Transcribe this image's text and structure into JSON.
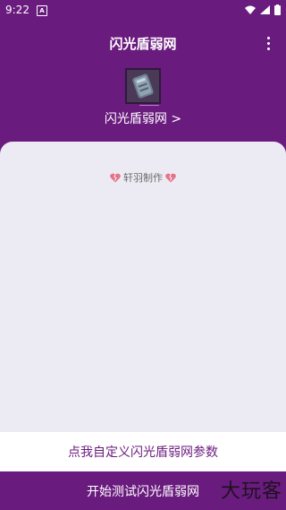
{
  "status": {
    "time": "9:22",
    "notification_glyph": "A"
  },
  "appbar": {
    "title": "闪光盾弱网",
    "menu_icon": "more-vertical-icon"
  },
  "hero": {
    "link_text": "闪光盾弱网 >"
  },
  "panel": {
    "credit_text": "轩羽制作"
  },
  "buttons": {
    "custom_label": "点我自定义闪光盾弱网参数",
    "start_label": "开始测试闪光盾弱网"
  },
  "watermark": "大玩客",
  "colors": {
    "primary": "#6a1b7e",
    "panel_bg": "#ecebf3",
    "button_bg": "#ffffff"
  }
}
